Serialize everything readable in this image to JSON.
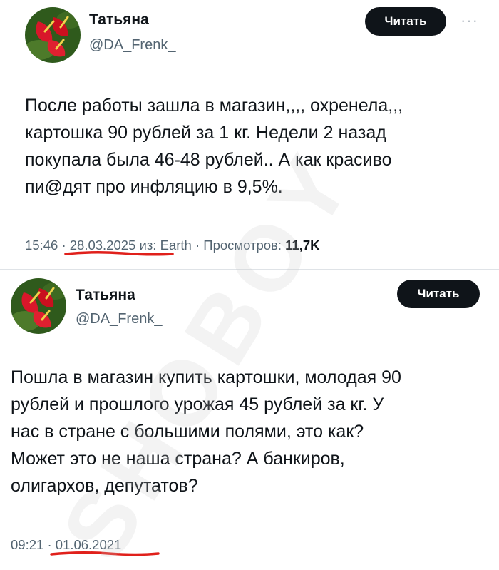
{
  "tweets": [
    {
      "name": "Татьяна",
      "handle": "@DA_Frenk_",
      "follow_label": "Читать",
      "more_icon": "···",
      "text_lines": [
        "После работы зашла в магазин,,,, охренела,,,",
        "картошка 90 рублей за 1 кг. Недели 2 назад",
        "покупала была 46-48 рублей.. А как красиво",
        "пи@дят про инфляцию в 9,5%."
      ],
      "time": "15:46",
      "sep": "·",
      "date": "28.03.2025",
      "source": "из: Earth",
      "views_label": "Просмотров:",
      "views_value": "11,7K"
    },
    {
      "name": "Татьяна",
      "handle": "@DA_Frenk_",
      "follow_label": "Читать",
      "text_lines": [
        "Пошла в магазин купить картошки, молодая 90",
        "рублей и прошлого урожая 45 рублей за кг. У",
        "нас в стране с большими полями, это как?",
        "Может это не наша страна? А банкиров,",
        "олигархов, депутатов?"
      ],
      "time": "09:21",
      "sep": "·",
      "date": "01.06.2021"
    }
  ],
  "watermark": "SHOBOY",
  "colors": {
    "underline": "#e0201b",
    "follow_bg": "#0f1419",
    "muted": "#536471",
    "watermark": "#c9c9c9"
  },
  "icons": {
    "avatar": "red-anthurium-flower-avatar",
    "more": "more-dots-icon"
  }
}
